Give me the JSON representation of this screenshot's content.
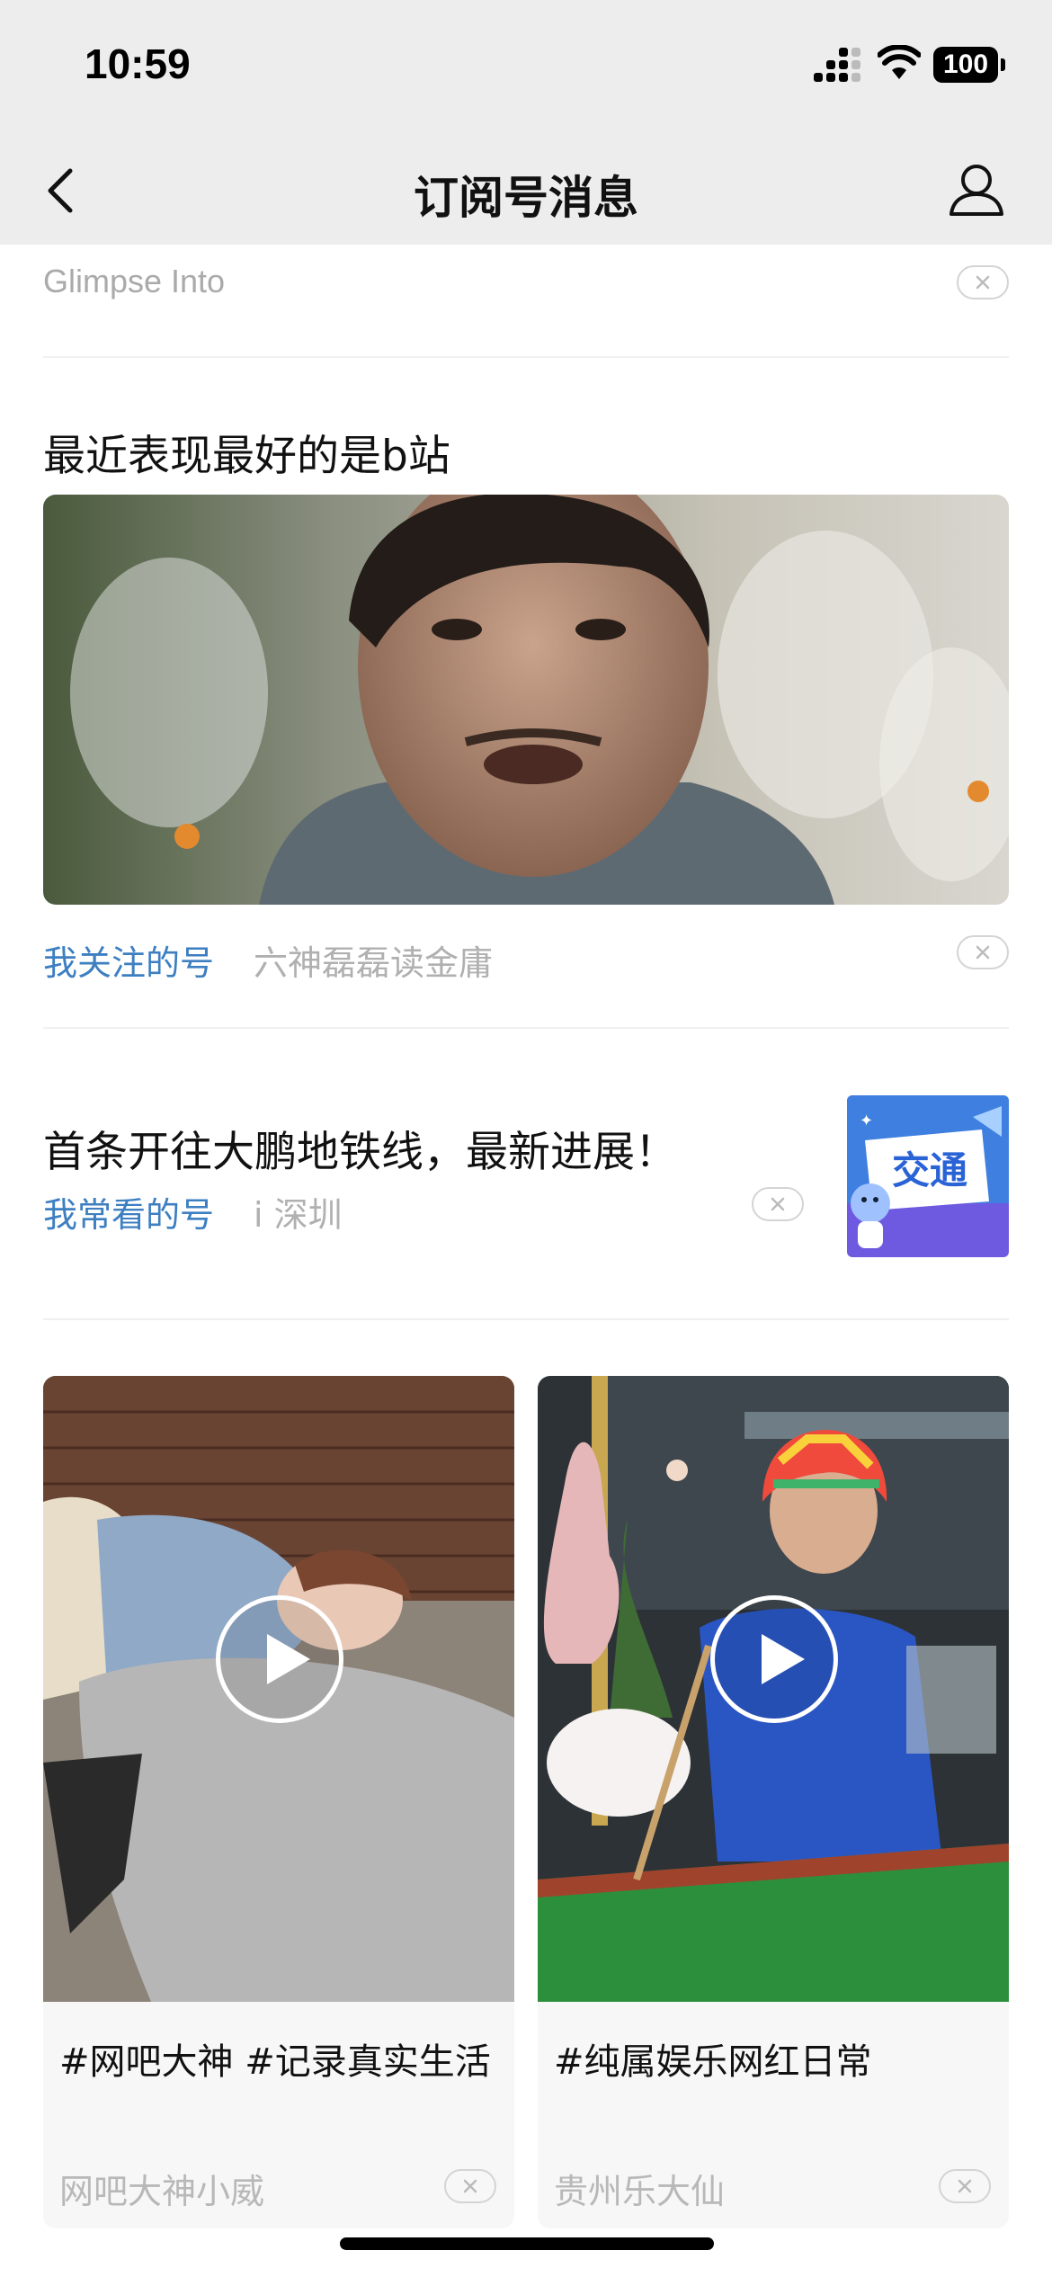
{
  "status_bar": {
    "time": "10:59",
    "battery": "100"
  },
  "nav": {
    "title": "订阅号消息"
  },
  "feed": {
    "item0": {
      "source_text": "Glimpse Into"
    },
    "item1": {
      "title": "最近表现最好的是b站",
      "tag": "我关注的号",
      "source": "六神磊磊读金庸"
    },
    "item2": {
      "title": "首条开往大鹏地铁线，最新进展！",
      "tag": "我常看的号",
      "source": "i 深圳",
      "thumb_text": "交通"
    },
    "video_cards": [
      {
        "title": "#网吧大神 #记录真实生活",
        "author": "网吧大神小威"
      },
      {
        "title": "#纯属娱乐网红日常",
        "author": "贵州乐大仙"
      }
    ]
  },
  "colors": {
    "tag_blue": "#3d7fc1",
    "nav_bg": "#ededed",
    "muted_text": "#b0b0b0"
  },
  "icons": [
    "back-arrow-icon",
    "profile-icon",
    "close-icon",
    "play-icon",
    "signal-icon",
    "wifi-icon",
    "battery-icon"
  ]
}
